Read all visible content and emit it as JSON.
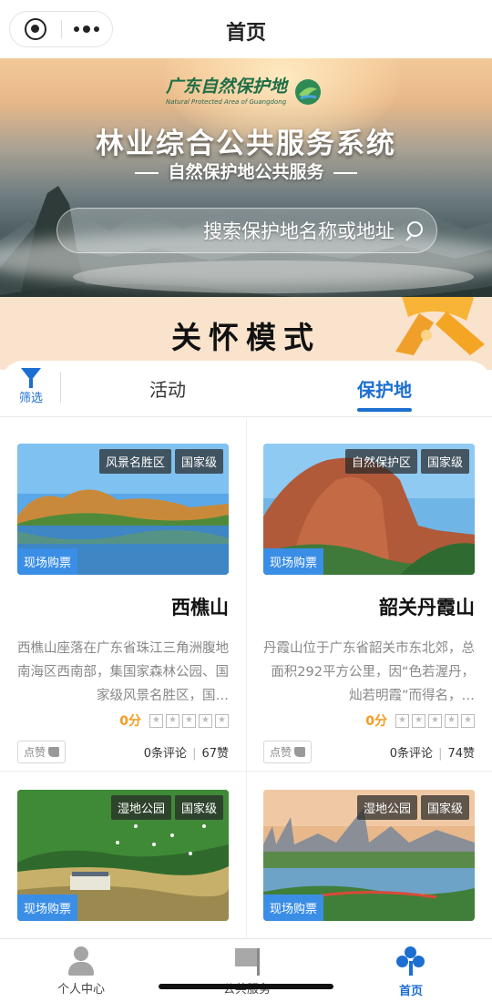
{
  "header": {
    "title": "首页"
  },
  "hero": {
    "logo_text": "广东自然保护地",
    "logo_sub": "Natural Protected Area of Guangdong",
    "title": "林业综合公共服务系统",
    "subtitle": "自然保护地公共服务",
    "search_placeholder": "搜索保护地名称或地址"
  },
  "care_mode": {
    "label": "关怀模式"
  },
  "tabs": {
    "filter_label": "筛选",
    "items": [
      {
        "label": "保护地",
        "active": true
      },
      {
        "label": "活动",
        "active": false
      }
    ]
  },
  "cards": [
    {
      "title": "韶关丹霞山",
      "badges": [
        "国家级",
        "自然保护区"
      ],
      "buy_label": "现场购票",
      "desc": "丹霞山位于广东省韶关市东北郊，总面积292平方公里，因“色若渥丹，灿若明霞”而得名，…",
      "score": "0分",
      "comments": "0条评论",
      "likes": "74赞",
      "like_label": "点赞"
    },
    {
      "title": "西樵山",
      "badges": [
        "国家级",
        "风景名胜区"
      ],
      "buy_label": "现场购票",
      "desc": "西樵山座落在广东省珠江三角洲腹地南海区西南部，集国家森林公园、国家级风景名胜区，国…",
      "score": "0分",
      "comments": "0条评论",
      "likes": "67赞",
      "like_label": "点赞"
    },
    {
      "title": "",
      "badges": [
        "国家级",
        "湿地公园"
      ],
      "buy_label": "现场购票"
    },
    {
      "title": "",
      "badges": [
        "国家级",
        "湿地公园"
      ],
      "buy_label": "现场购票"
    }
  ],
  "bottom_nav": [
    {
      "label": "首页",
      "icon": "home-icon",
      "active": true
    },
    {
      "label": "公共服务",
      "icon": "flag-icon",
      "active": false
    },
    {
      "label": "个人中心",
      "icon": "person-icon",
      "active": false
    }
  ],
  "colors": {
    "accent": "#1c6ed0",
    "score": "#f29c1f",
    "care_bg": "#fae3cc",
    "buy_badge": "#3a8ee6"
  }
}
